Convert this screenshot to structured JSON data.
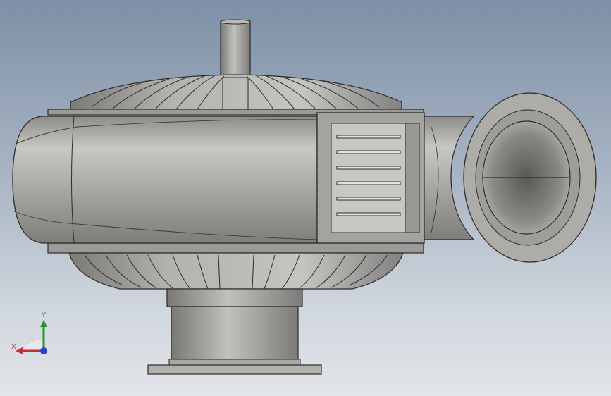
{
  "viewport": {
    "background_top": "#7e90a6",
    "background_bottom": "#e2e5e9"
  },
  "model": {
    "body_color": "#a8a6a3",
    "shade_color": "#8a8885",
    "edge_color": "#2b2b2b",
    "highlight_color": "#d6d4d0"
  },
  "triad": {
    "x_label": "X",
    "y_label": "Y",
    "x_color": "#c43030",
    "y_color": "#2e8f2e",
    "z_color": "#2f3fd0"
  }
}
